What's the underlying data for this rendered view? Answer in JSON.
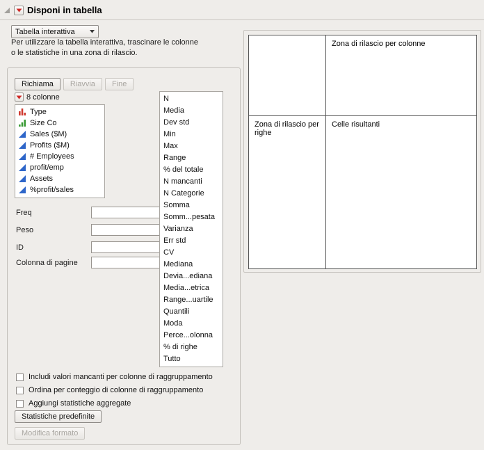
{
  "colors": {
    "accent-red": "#cf2a27",
    "continuous-blue": "#2e66c9",
    "ordinal-green": "#3a9b35",
    "nominal-red": "#d03a30"
  },
  "header": {
    "title": "Disponi in tabella"
  },
  "mode_select": {
    "value": "Tabella interattiva"
  },
  "instructions": {
    "line1": "Per utilizzare la tabella interattiva, trascinare le colonne",
    "line2": "o le statistiche in una zona di rilascio."
  },
  "control_panel": {
    "buttons": {
      "recall": "Richiama",
      "restart": "Riavvia",
      "done": "Fine"
    },
    "columns_header": "8 colonne",
    "columns": [
      {
        "name": "Type",
        "icon": "nominal-icon"
      },
      {
        "name": "Size Co",
        "icon": "ordinal-icon"
      },
      {
        "name": "Sales ($M)",
        "icon": "continuous-icon"
      },
      {
        "name": "Profits ($M)",
        "icon": "continuous-icon"
      },
      {
        "name": "# Employees",
        "icon": "continuous-icon"
      },
      {
        "name": "profit/emp",
        "icon": "continuous-icon"
      },
      {
        "name": "Assets",
        "icon": "continuous-icon"
      },
      {
        "name": "%profit/sales",
        "icon": "continuous-icon"
      }
    ],
    "fields": [
      {
        "label": "Freq",
        "value": ""
      },
      {
        "label": "Peso",
        "value": ""
      },
      {
        "label": "ID",
        "value": ""
      },
      {
        "label": "Colonna di pagine",
        "value": ""
      }
    ],
    "statistics": [
      "N",
      "Media",
      "Dev std",
      "Min",
      "Max",
      "Range",
      "% del totale",
      "N mancanti",
      "N Categorie",
      "Somma",
      "Somm...pesata",
      "Varianza",
      "Err std",
      "CV",
      "Mediana",
      "Devia...ediana",
      "Media...etrica",
      "Range...uartile",
      "Quantili",
      "Moda",
      "Perce...olonna",
      "% di righe",
      "Tutto"
    ],
    "checkboxes": [
      {
        "label": "Includi valori mancanti per colonne di raggruppamento",
        "checked": false
      },
      {
        "label": "Ordina per conteggio di colonne di raggruppamento",
        "checked": false
      },
      {
        "label": "Aggiungi statistiche aggregate",
        "checked": false
      }
    ],
    "default_stats_button": "Statistiche predefinite",
    "change_format_button": "Modifica formato"
  },
  "dropzone": {
    "column_zone": "Zona di rilascio per colonne",
    "row_zone": "Zona di rilascio per righe",
    "result_cells": "Celle risultanti"
  }
}
